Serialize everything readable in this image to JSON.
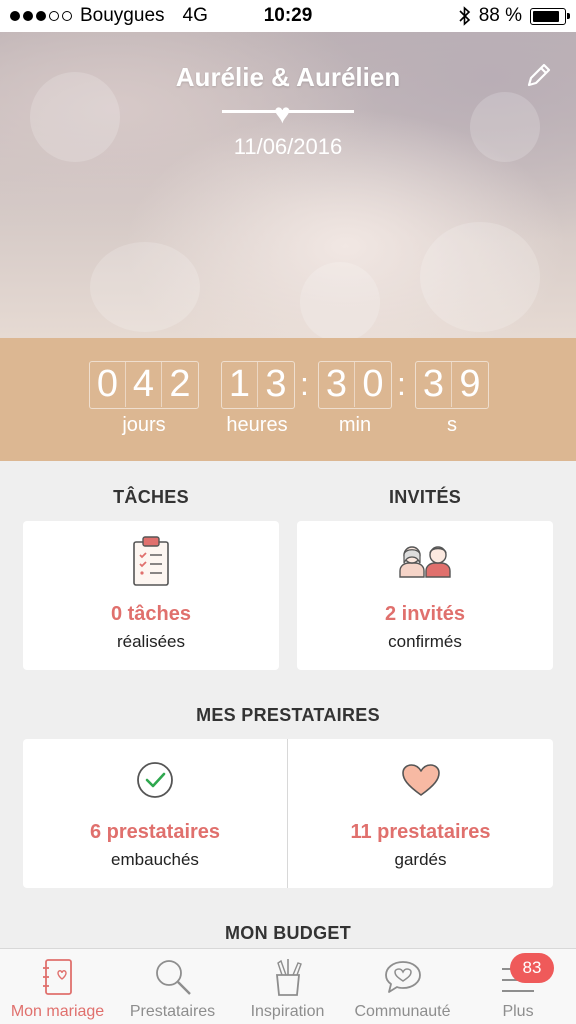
{
  "status_bar": {
    "carrier": "Bouygues",
    "network": "4G",
    "time": "10:29",
    "battery": "88 %",
    "battery_level": 0.88
  },
  "hero": {
    "couple": "Aurélie & Aurélien",
    "date": "11/06/2016"
  },
  "countdown": {
    "days": [
      "0",
      "4",
      "2"
    ],
    "hours": [
      "1",
      "3"
    ],
    "minutes": [
      "3",
      "0"
    ],
    "seconds": [
      "3",
      "9"
    ],
    "labels": {
      "days": "jours",
      "hours": "heures",
      "minutes": "min",
      "seconds": "s"
    }
  },
  "tasks": {
    "title": "TÂCHES",
    "count": "0 tâches",
    "sub": "réalisées"
  },
  "guests": {
    "title": "INVITÉS",
    "count": "2 invités",
    "sub": "confirmés"
  },
  "vendors": {
    "title": "MES PRESTATAIRES",
    "hired": {
      "count": "6 prestataires",
      "sub": "embauchés"
    },
    "saved": {
      "count": "11 prestataires",
      "sub": "gardés"
    }
  },
  "budget": {
    "title": "MON BUDGET"
  },
  "tab_bar": {
    "items": [
      {
        "label": "Mon mariage",
        "icon": "notebook-icon"
      },
      {
        "label": "Prestataires",
        "icon": "search-icon"
      },
      {
        "label": "Inspiration",
        "icon": "pencil-cup-icon"
      },
      {
        "label": "Communauté",
        "icon": "chat-heart-icon"
      },
      {
        "label": "Plus",
        "icon": "menu-icon"
      }
    ],
    "badge": "83"
  },
  "colors": {
    "accent": "#e0706d",
    "countdown_bg": "#dcb792",
    "badge": "#ef5a5a"
  }
}
